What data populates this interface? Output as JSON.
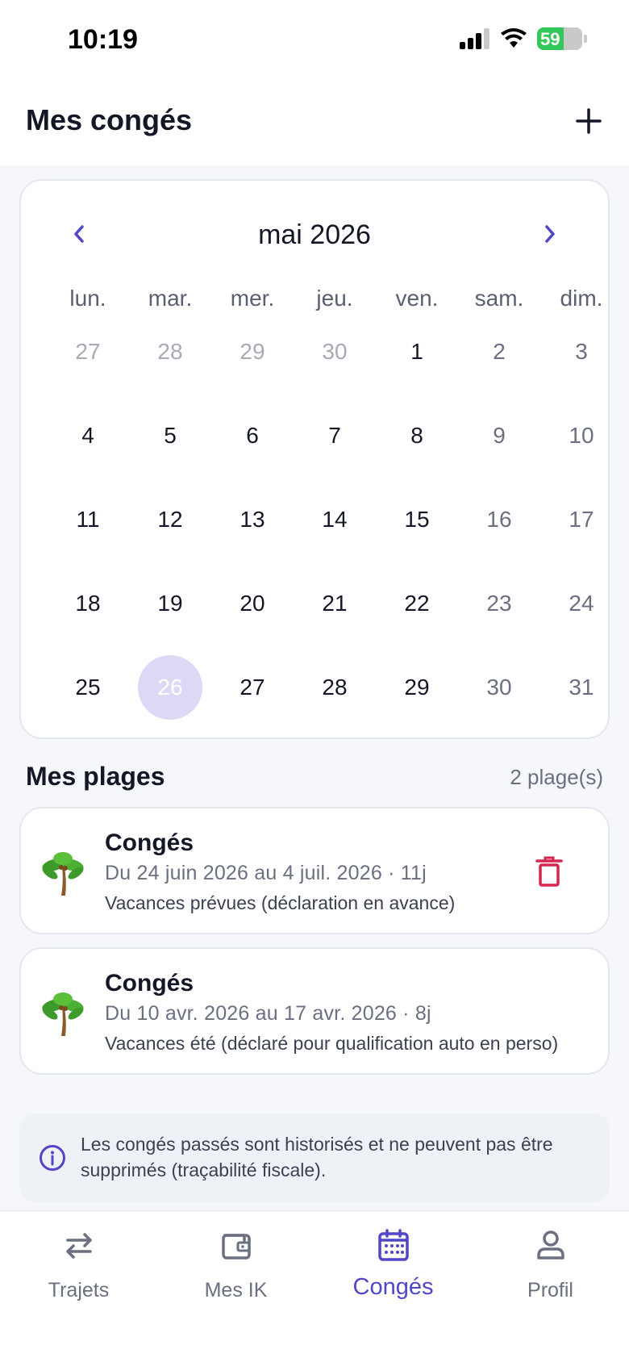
{
  "status": {
    "time": "10:19",
    "battery": "59",
    "battery_level": 0.59
  },
  "header": {
    "title": "Mes congés"
  },
  "calendar": {
    "month": "mai 2026",
    "weekdays": [
      "lun.",
      "mar.",
      "mer.",
      "jeu.",
      "ven.",
      "sam.",
      "dim."
    ],
    "weeks": [
      [
        "27",
        "28",
        "29",
        "30",
        "1",
        "2",
        "3"
      ],
      [
        "4",
        "5",
        "6",
        "7",
        "8",
        "9",
        "10"
      ],
      [
        "11",
        "12",
        "13",
        "14",
        "15",
        "16",
        "17"
      ],
      [
        "18",
        "19",
        "20",
        "21",
        "22",
        "23",
        "24"
      ],
      [
        "25",
        "26",
        "27",
        "28",
        "29",
        "30",
        "31"
      ]
    ],
    "outside_month_days": [
      "27",
      "28",
      "29",
      "30"
    ],
    "selected_day": "26"
  },
  "ranges": {
    "title": "Mes plages",
    "count": "2 plage(s)",
    "items": [
      {
        "title": "Congés",
        "dates": "Du 24 juin 2026 au 4 juil. 2026 · 11j",
        "note": "Vacances prévues (déclaration en avance)",
        "deletable": true
      },
      {
        "title": "Congés",
        "dates": "Du 10 avr. 2026 au 17 avr. 2026 · 8j",
        "note": "Vacances été (déclaré pour qualification auto en perso)",
        "deletable": false
      }
    ]
  },
  "info": {
    "text": "Les congés passés sont historisés et ne peuvent pas être supprimés (traçabilité fiscale)."
  },
  "tabs": [
    {
      "label": "Trajets",
      "icon": "swap-arrows-icon"
    },
    {
      "label": "Mes IK",
      "icon": "wallet-icon"
    },
    {
      "label": "Congés",
      "icon": "calendar-icon",
      "active": true
    },
    {
      "label": "Profil",
      "icon": "user-icon"
    }
  ],
  "colors": {
    "accent": "#4f46c8",
    "danger": "#d6264f",
    "selected_day_bg": "#dcd9f5",
    "battery": "#34c759"
  }
}
